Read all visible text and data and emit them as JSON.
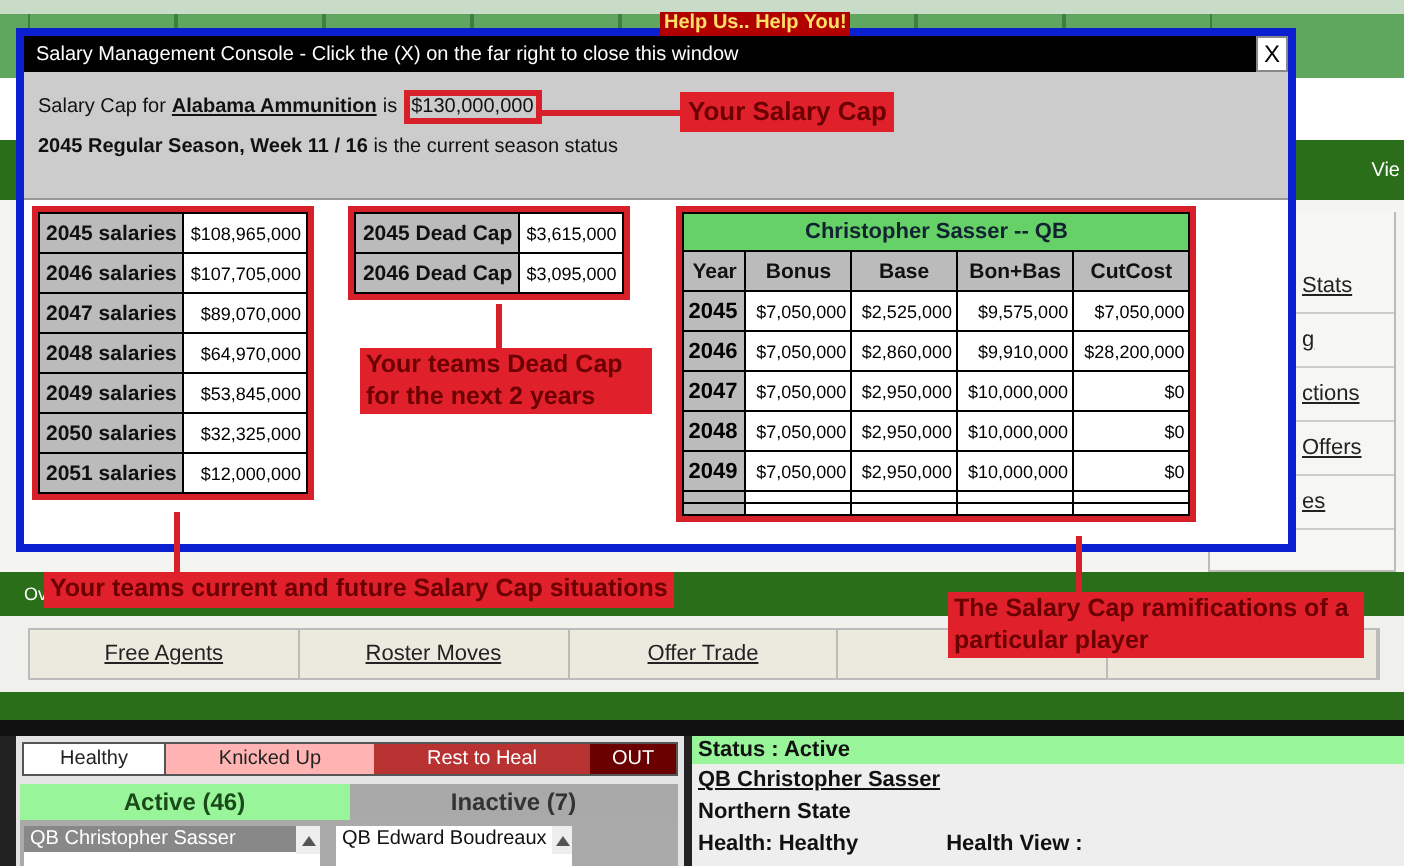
{
  "background": {
    "header_link": "Vie",
    "side_links": [
      "Stats",
      "g",
      "ctions",
      "Offers",
      "es"
    ],
    "bar_label": "Ov",
    "nav_links": [
      "Free Agents",
      "Roster Moves",
      "Offer Trade"
    ]
  },
  "window": {
    "title": "Salary Management Console - Click the (X) on the far right to close this window",
    "close": "X",
    "banner": "Help Us.. Help You!"
  },
  "cap_line": {
    "prefix": "Salary Cap for",
    "team": "Alabama Ammunition",
    "connector": "is",
    "value": "$130,000,000"
  },
  "season_status": "**2045 Regular Season, Week 11 / 16** is the current season status",
  "salaries": [
    {
      "label": "2045 salaries",
      "value": "$108,965,000"
    },
    {
      "label": "2046 salaries",
      "value": "$107,705,000"
    },
    {
      "label": "2047 salaries",
      "value": "$89,070,000"
    },
    {
      "label": "2048 salaries",
      "value": "$64,970,000"
    },
    {
      "label": "2049 salaries",
      "value": "$53,845,000"
    },
    {
      "label": "2050 salaries",
      "value": "$32,325,000"
    },
    {
      "label": "2051 salaries",
      "value": "$12,000,000"
    }
  ],
  "dead_cap": [
    {
      "label": "2045 Dead Cap",
      "value": "$3,615,000"
    },
    {
      "label": "2046 Dead Cap",
      "value": "$3,095,000"
    }
  ],
  "player_table": {
    "title": "Christopher Sasser -- QB",
    "columns": [
      "Year",
      "Bonus",
      "Base",
      "Bon+Bas",
      "CutCost"
    ],
    "rows": [
      [
        "2045",
        "$7,050,000",
        "$2,525,000",
        "$9,575,000",
        "$7,050,000"
      ],
      [
        "2046",
        "$7,050,000",
        "$2,860,000",
        "$9,910,000",
        "$28,200,000"
      ],
      [
        "2047",
        "$7,050,000",
        "$2,950,000",
        "$10,000,000",
        "$0"
      ],
      [
        "2048",
        "$7,050,000",
        "$2,950,000",
        "$10,000,000",
        "$0"
      ],
      [
        "2049",
        "$7,050,000",
        "$2,950,000",
        "$10,000,000",
        "$0"
      ]
    ]
  },
  "callouts": [
    {
      "text": "Your Salary Cap"
    },
    {
      "text": "Your teams Dead Cap for the next 2 years"
    },
    {
      "text": "Your teams current and future Salary Cap situations"
    },
    {
      "text": "The Salary Cap ramifications of a particular player"
    }
  ],
  "legend": [
    {
      "label": "Healthy",
      "color": "#ffffff"
    },
    {
      "label": "Knicked Up",
      "color": "#ffb3b3"
    },
    {
      "label": "Rest to Heal",
      "color": "#b83232"
    },
    {
      "label": "OUT",
      "color": "#6a0000"
    }
  ],
  "roster_tabs": [
    {
      "label": "Active (46)",
      "selected": true
    },
    {
      "label": "Inactive (7)",
      "selected": false
    }
  ],
  "active_list": [
    {
      "text": "QB Christopher Sasser",
      "selected": true
    }
  ],
  "inactive_list": [
    {
      "text": "QB Edward Boudreaux",
      "selected": false
    }
  ],
  "player_panel": {
    "status": "Status : Active",
    "name": "QB Christopher Sasser",
    "school": "Northern State",
    "health": "Health: Healthy",
    "health_view": "Health View :"
  }
}
